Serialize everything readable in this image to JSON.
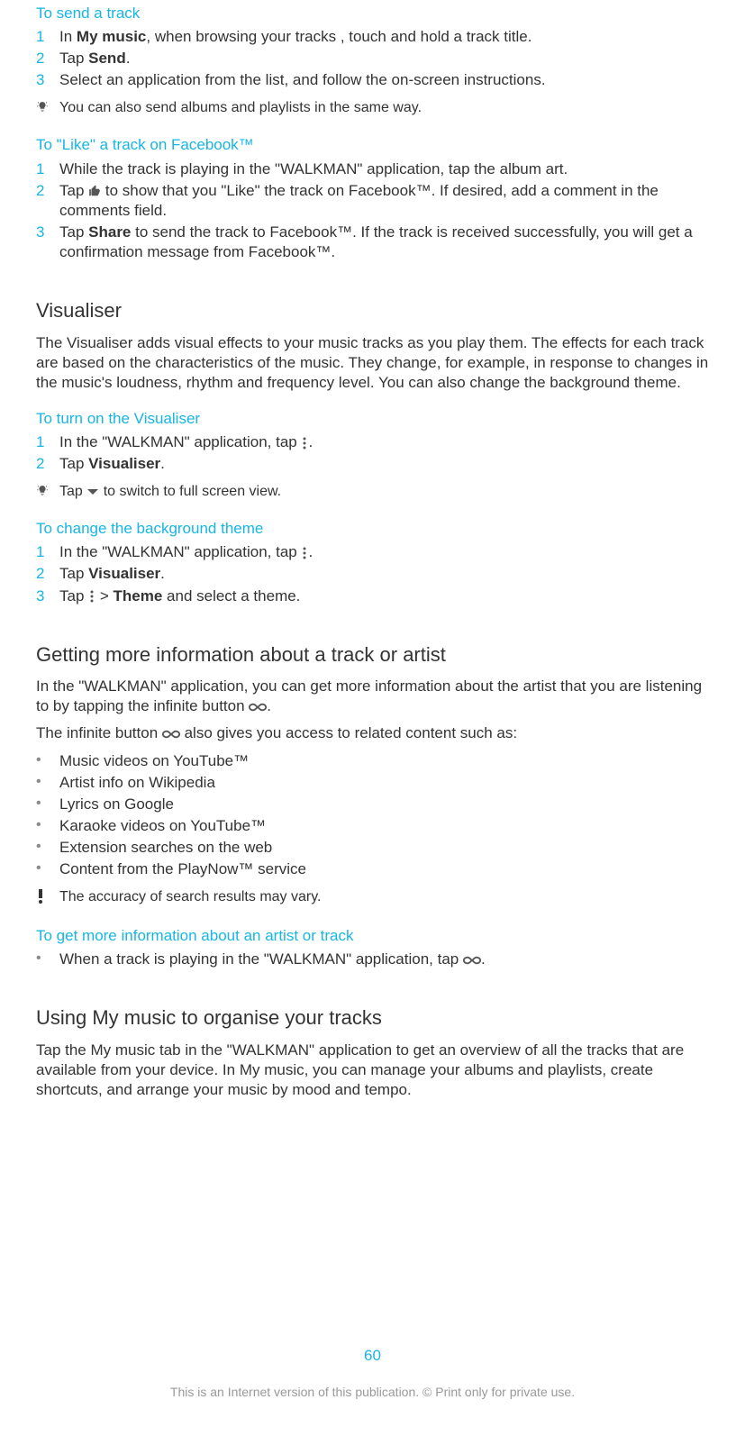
{
  "s1": {
    "heading": "To send a track",
    "step1_a": "In ",
    "step1_b": "My music",
    "step1_c": ", when browsing your tracks , touch and hold a track title.",
    "step2_a": "Tap ",
    "step2_b": "Send",
    "step2_c": ".",
    "step3": "Select an application from the list, and follow the on-screen instructions.",
    "tip": "You can also send albums and playlists in the same way."
  },
  "s2": {
    "heading": "To \"Like\" a track on Facebook™",
    "step1": "While the track is playing in the \"WALKMAN\" application, tap the album art.",
    "step2_a": "Tap ",
    "step2_b": "to show that you \"Like\" the track on Facebook™. If desired, add a comment in the comments field.",
    "step3_a": "Tap ",
    "step3_b": "Share",
    "step3_c": " to send the track to Facebook™. If the track is received successfully, you will get a confirmation message from Facebook™."
  },
  "s3": {
    "heading": "Visualiser",
    "para": "The Visualiser adds visual effects to your music tracks as you play them. The effects for each track are based on the characteristics of the music. They change, for example, in response to changes in the music's loudness, rhythm and frequency level. You can also change the background theme."
  },
  "s4": {
    "heading": "To turn on the Visualiser",
    "step1_a": "In the \"WALKMAN\" application, tap ",
    "step1_b": ".",
    "step2_a": "Tap ",
    "step2_b": "Visualiser",
    "step2_c": ".",
    "tip_a": "Tap ",
    "tip_b": " to switch to full screen view."
  },
  "s5": {
    "heading": "To change the background theme",
    "step1_a": "In the \"WALKMAN\" application, tap ",
    "step1_b": ".",
    "step2_a": "Tap ",
    "step2_b": "Visualiser",
    "step2_c": ".",
    "step3_a": "Tap ",
    "step3_b": " > ",
    "step3_c": "Theme",
    "step3_d": " and select a theme."
  },
  "s6": {
    "heading": "Getting more information about a track or artist",
    "p1_a": "In the \"WALKMAN\" application, you can get more information about the artist that you are listening to by tapping the infinite button ",
    "p1_b": ".",
    "p2_a": "The infinite button ",
    "p2_b": " also gives you access to related content such as:",
    "bullets": [
      "Music videos on YouTube™",
      "Artist info on Wikipedia",
      "Lyrics on Google",
      "Karaoke videos on YouTube™",
      "Extension searches on the web",
      "Content from the PlayNow™ service"
    ],
    "note": "The accuracy of search results may vary."
  },
  "s7": {
    "heading": "To get more information about an artist or track",
    "step_a": "When a track is playing in the \"WALKMAN\" application, tap ",
    "step_b": "."
  },
  "s8": {
    "heading": "Using My music to organise your tracks",
    "para": "Tap the My music tab in the \"WALKMAN\" application to get an overview of all the tracks that are available from your device. In My music, you can manage your albums and playlists, create shortcuts, and arrange your music by mood and tempo."
  },
  "footer": {
    "page": "60",
    "copyright": "This is an Internet version of this publication. © Print only for private use."
  },
  "nums": {
    "1": "1",
    "2": "2",
    "3": "3"
  }
}
